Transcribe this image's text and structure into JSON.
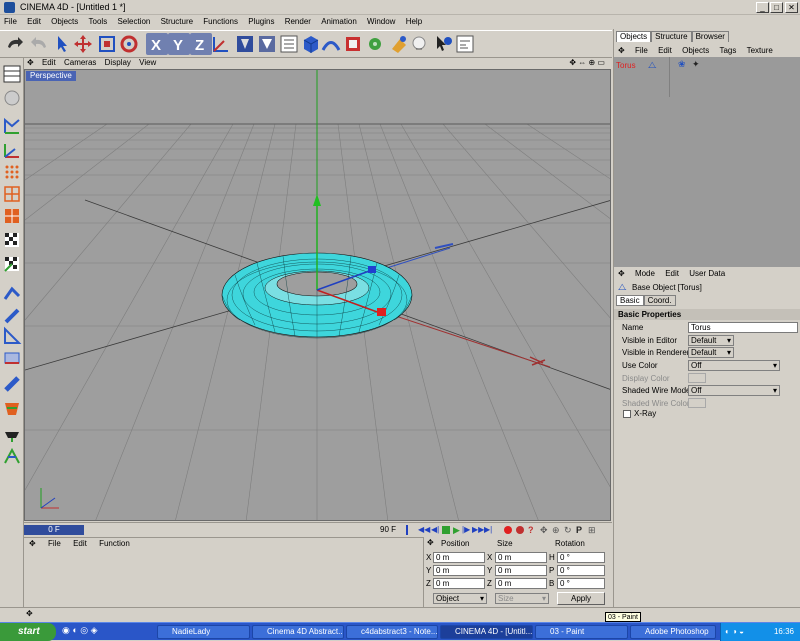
{
  "window": {
    "title": "CINEMA 4D - [Untitled 1 *]",
    "min": "_",
    "max": "□",
    "close": "✕"
  },
  "menubar": [
    "File",
    "Edit",
    "Objects",
    "Tools",
    "Selection",
    "Structure",
    "Functions",
    "Plugins",
    "Render",
    "Animation",
    "Window",
    "Help"
  ],
  "toolbar": {
    "axis_x": "X",
    "axis_y": "Y",
    "axis_z": "Z"
  },
  "viewport": {
    "menu": [
      "Edit",
      "Cameras",
      "Display",
      "View"
    ],
    "label": "Perspective"
  },
  "timeline": {
    "current_frame": "0 F",
    "end_frame": "90 F"
  },
  "anim_panel": {
    "menu": [
      "File",
      "Edit",
      "Function"
    ]
  },
  "coords": {
    "headers": [
      "Position",
      "Size",
      "Rotation"
    ],
    "rows": [
      {
        "pos_label": "X",
        "pos": "0 m",
        "size_label": "X",
        "size": "0 m",
        "rot_label": "H",
        "rot": "0 °"
      },
      {
        "pos_label": "Y",
        "pos": "0 m",
        "size_label": "Y",
        "size": "0 m",
        "rot_label": "P",
        "rot": "0 °"
      },
      {
        "pos_label": "Z",
        "pos": "0 m",
        "size_label": "Z",
        "size": "0 m",
        "rot_label": "B",
        "rot": "0 °"
      }
    ],
    "mode": "Object",
    "size_mode": "Size",
    "apply": "Apply"
  },
  "objects_panel": {
    "tabs": [
      "Objects",
      "Structure",
      "Browser"
    ],
    "menu": [
      "File",
      "Edit",
      "Objects",
      "Tags",
      "Texture"
    ],
    "items": [
      {
        "name": "Torus"
      }
    ]
  },
  "attributes_panel": {
    "menu": [
      "Mode",
      "Edit",
      "User Data"
    ],
    "header": "Base Object [Torus]",
    "tabs": [
      "Basic",
      "Coord."
    ],
    "section": "Basic Properties",
    "name_label": "Name",
    "name_value": "Torus",
    "visible_editor_label": "Visible in Editor",
    "visible_editor_value": "Default",
    "visible_renderer_label": "Visible in Renderer",
    "visible_renderer_value": "Default",
    "use_color_label": "Use Color",
    "use_color_value": "Off",
    "display_color_label": "Display Color",
    "shaded_wire_mode_label": "Shaded Wire Mode",
    "shaded_wire_mode_value": "Off",
    "shaded_wire_color_label": "Shaded Wire Color",
    "xray_label": "X-Ray"
  },
  "taskbar": {
    "start": "start",
    "tasks": [
      "NadieLady",
      "Cinema 4D Abstract...",
      "c4dabstract3 - Note...",
      "CINEMA 4D - [Untitl...",
      "03 - Paint",
      "Adobe Photoshop"
    ],
    "time": "16:36"
  },
  "tooltip": "03 - Paint",
  "colors": {
    "viewport_bg": "#9e9e9e",
    "torus": "#3fe0e6",
    "accent": "#304c9c"
  }
}
